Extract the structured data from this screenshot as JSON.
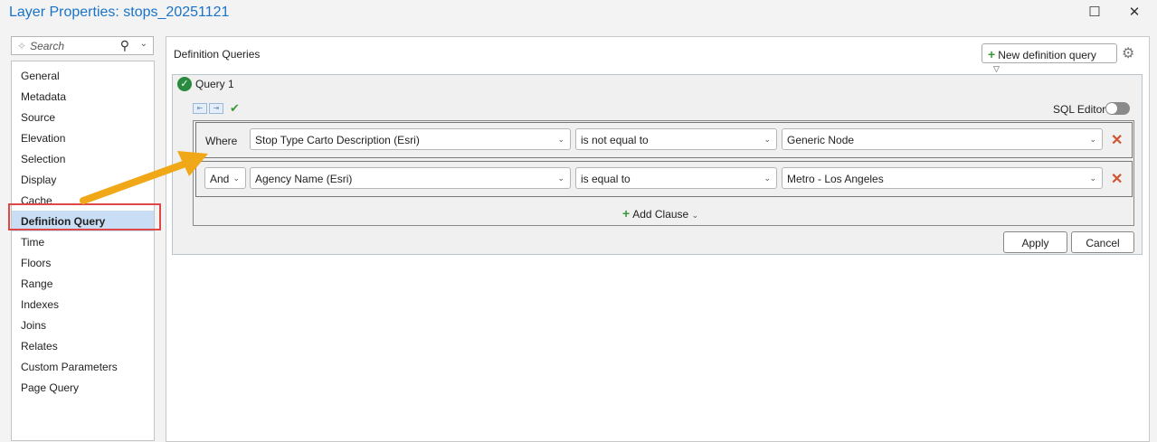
{
  "window": {
    "title": "Layer Properties: stops_20251121",
    "maximize": "☐",
    "close": "✕"
  },
  "sidebar": {
    "search_placeholder": "Search",
    "items": [
      {
        "label": "General"
      },
      {
        "label": "Metadata"
      },
      {
        "label": "Source"
      },
      {
        "label": "Elevation"
      },
      {
        "label": "Selection"
      },
      {
        "label": "Display"
      },
      {
        "label": "Cache"
      },
      {
        "label": "Definition Query",
        "selected": true
      },
      {
        "label": "Time"
      },
      {
        "label": "Floors"
      },
      {
        "label": "Range"
      },
      {
        "label": "Indexes"
      },
      {
        "label": "Joins"
      },
      {
        "label": "Relates"
      },
      {
        "label": "Custom Parameters"
      },
      {
        "label": "Page Query"
      }
    ]
  },
  "main": {
    "heading": "Definition Queries",
    "new_query_label": "New definition query",
    "query": {
      "title": "Query 1",
      "sql_editor_label": "SQL Editor",
      "sql_editor_on": false,
      "clauses": [
        {
          "connector": "Where",
          "field": "Stop Type Carto Description (Esri)",
          "operator": "is not equal to",
          "value": "Generic Node"
        },
        {
          "connector": "And",
          "field": "Agency Name (Esri)",
          "operator": "is equal to",
          "value": "Metro - Los Angeles"
        }
      ],
      "add_clause_label": "Add Clause",
      "apply_label": "Apply",
      "cancel_label": "Cancel"
    }
  },
  "colors": {
    "accent": "#1a73c8",
    "selected": "#c9def5",
    "highlight": "#e04848",
    "arrow": "#f0a818",
    "delete": "#d0542f"
  }
}
